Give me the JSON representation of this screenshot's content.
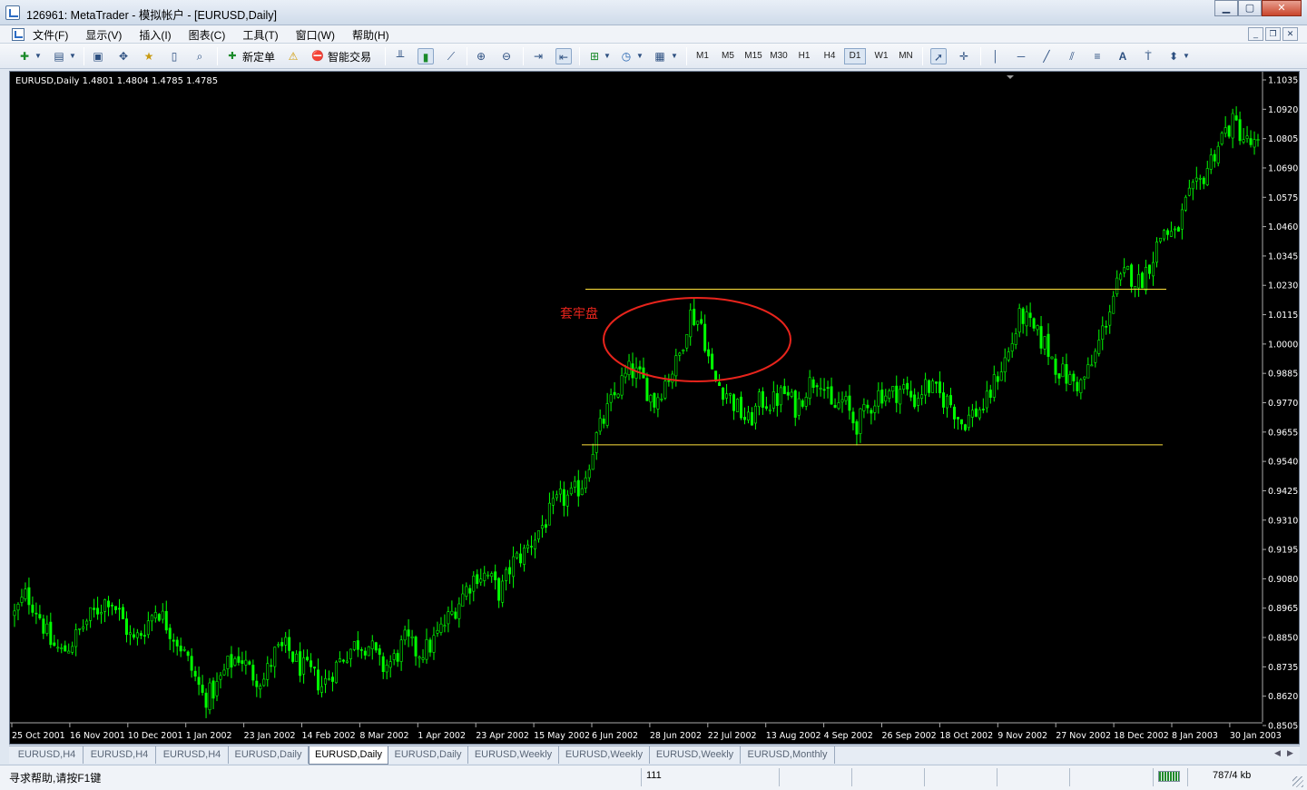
{
  "window": {
    "title": "126961: MetaTrader - 模拟帐户 - [EURUSD,Daily]"
  },
  "menu": {
    "items": [
      "文件(F)",
      "显示(V)",
      "插入(I)",
      "图表(C)",
      "工具(T)",
      "窗口(W)",
      "帮助(H)"
    ]
  },
  "toolbar": {
    "new_order_label": "新定单",
    "expert_label": "智能交易",
    "timeframes": [
      "M1",
      "M5",
      "M15",
      "M30",
      "H1",
      "H4",
      "D1",
      "W1",
      "MN"
    ],
    "active_timeframe": "D1"
  },
  "chart": {
    "info": "EURUSD,Daily  1.4801 1.4804 1.4785 1.4785",
    "annotation_text": "套牢盘",
    "annotation_color": "#e8241c",
    "candle_color": "#00ff00",
    "level_line_color": "#ffe13c"
  },
  "chart_data": {
    "type": "candlestick",
    "symbol": "EURUSD",
    "timeframe": "Daily",
    "y_ticks": [
      "1.1035",
      "1.0920",
      "1.0805",
      "1.0690",
      "1.0575",
      "1.0460",
      "1.0345",
      "1.0230",
      "1.0115",
      "1.0000",
      "0.9885",
      "0.9770",
      "0.9655",
      "0.9540",
      "0.9425",
      "0.9310",
      "0.9195",
      "0.9080",
      "0.8965",
      "0.8850",
      "0.8735",
      "0.8620",
      "0.8505"
    ],
    "ylim": [
      0.8505,
      1.1035
    ],
    "x_ticks": [
      "25 Oct 2001",
      "16 Nov 2001",
      "10 Dec 2001",
      "1 Jan 2002",
      "23 Jan 2002",
      "14 Feb 2002",
      "8 Mar 2002",
      "1 Apr 2002",
      "23 Apr 2002",
      "15 May 2002",
      "6 Jun 2002",
      "28 Jun 2002",
      "22 Jul 2002",
      "13 Aug 2002",
      "4 Sep 2002",
      "26 Sep 2002",
      "18 Oct 2002",
      "9 Nov 2002",
      "27 Nov 2002",
      "18 Dec 2002",
      "8 Jan 2003",
      "30 Jan 2003"
    ],
    "resistance_level": 1.0215,
    "support_level": 0.9605,
    "trend_closes": [
      0.894,
      0.902,
      0.895,
      0.883,
      0.879,
      0.884,
      0.891,
      0.896,
      0.901,
      0.893,
      0.883,
      0.889,
      0.897,
      0.889,
      0.882,
      0.872,
      0.861,
      0.865,
      0.874,
      0.878,
      0.871,
      0.868,
      0.879,
      0.881,
      0.874,
      0.871,
      0.866,
      0.873,
      0.879,
      0.883,
      0.882,
      0.873,
      0.876,
      0.884,
      0.879,
      0.881,
      0.888,
      0.895,
      0.903,
      0.91,
      0.909,
      0.902,
      0.914,
      0.918,
      0.925,
      0.932,
      0.939,
      0.94,
      0.946,
      0.962,
      0.973,
      0.983,
      0.99,
      0.986,
      0.977,
      0.986,
      0.993,
      1.012,
      1.008,
      0.986,
      0.982,
      0.975,
      0.969,
      0.978,
      0.977,
      0.981,
      0.975,
      0.984,
      0.988,
      0.974,
      0.978,
      0.968,
      0.974,
      0.981,
      0.98,
      0.983,
      0.978,
      0.984,
      0.98,
      0.977,
      0.969,
      0.973,
      0.976,
      0.988,
      0.997,
      1.012,
      1.005,
      1.0,
      0.991,
      0.986,
      0.984,
      0.992,
      1.007,
      1.022,
      1.028,
      1.024,
      1.033,
      1.045,
      1.042,
      1.056,
      1.062,
      1.072,
      1.082,
      1.087,
      1.079,
      1.077
    ]
  },
  "tabs": {
    "items": [
      "EURUSD,H4",
      "EURUSD,H4",
      "EURUSD,H4",
      "EURUSD,Daily",
      "EURUSD,Daily",
      "EURUSD,Daily",
      "EURUSD,Weekly",
      "EURUSD,Weekly",
      "EURUSD,Weekly",
      "EURUSD,Monthly"
    ],
    "active_index": 4
  },
  "status": {
    "help": "寻求帮助,请按F1键",
    "count": "111",
    "traffic": "787/4 kb"
  }
}
